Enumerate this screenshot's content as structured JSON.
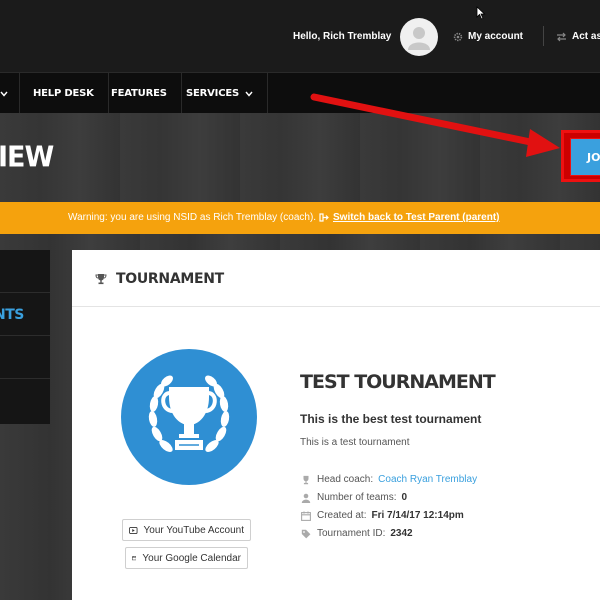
{
  "topbar": {
    "greeting": "Hello, Rich Tremblay",
    "my_account": "My account",
    "act_as": "Act as"
  },
  "nav": {
    "items": [
      {
        "label": "HELP DESK"
      },
      {
        "label": "FEATURES"
      },
      {
        "label": "SERVICES"
      }
    ]
  },
  "header": {
    "title_fragment": "IEW",
    "join_button": "JO"
  },
  "warning": {
    "text": "Warning: you are using NSID as Rich Tremblay (coach).",
    "link": "Switch back to Test Parent (parent)"
  },
  "side_menu": {
    "active_label": "NTS"
  },
  "panel": {
    "title": "TOURNAMENT",
    "youtube_button": "Your YouTube Account",
    "calendar_button": "Your Google Calendar"
  },
  "tournament": {
    "name": "TEST TOURNAMENT",
    "subtitle": "This is the best test tournament",
    "description": "This is a test tournament",
    "head_coach_label": "Head coach:",
    "head_coach_value": "Coach Ryan Tremblay",
    "teams_label": "Number of teams:",
    "teams_value": "0",
    "created_label": "Created at:",
    "created_value": "Fri 7/14/17 12:14pm",
    "id_label": "Tournament ID:",
    "id_value": "2342"
  },
  "colors": {
    "accent_blue": "#3aa0de",
    "warning_orange": "#f5a20d",
    "annotation_red": "#e11111"
  },
  "icons": [
    "cursor-icon",
    "gear-icon",
    "swap-icon",
    "chevron-down-icon",
    "trophy-icon",
    "signout-icon",
    "youtube-icon",
    "calendar-icon",
    "user-icon",
    "tag-icon"
  ]
}
